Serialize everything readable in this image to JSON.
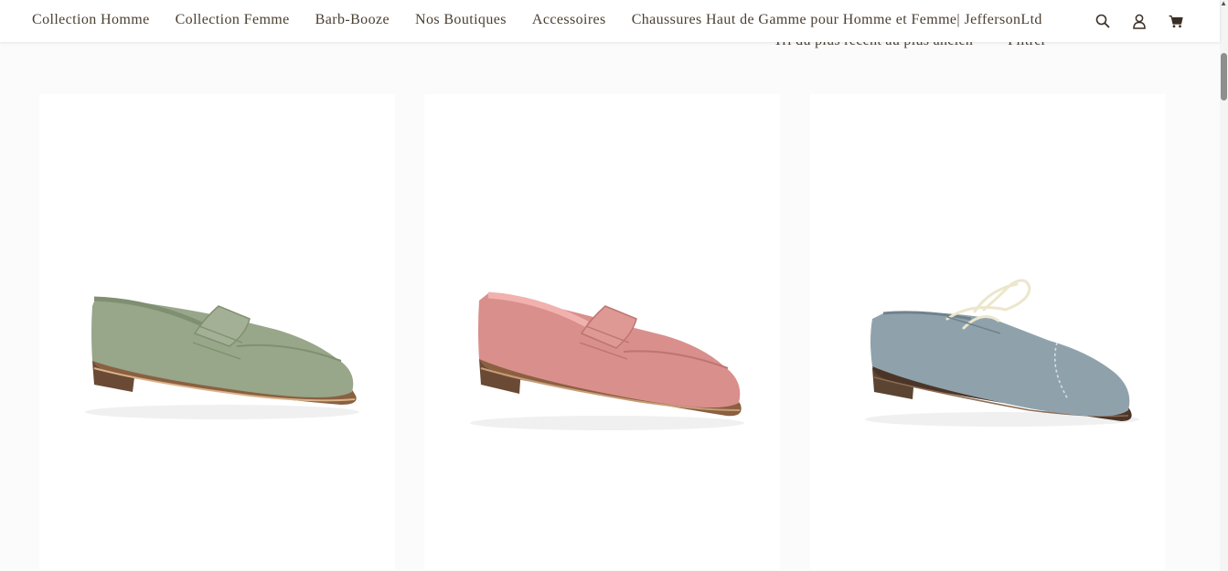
{
  "nav": {
    "links": [
      {
        "label": "Collection Homme"
      },
      {
        "label": "Collection Femme"
      },
      {
        "label": "Barb-Booze"
      },
      {
        "label": "Nos Boutiques"
      },
      {
        "label": "Accessoires"
      },
      {
        "label": "Chaussures Haut de Gamme pour Homme et Femme| JeffersonLtd"
      }
    ],
    "icons": [
      "search-icon",
      "account-icon",
      "cart-icon"
    ]
  },
  "toolbar": {
    "sort_label": "Tri du plus récent au plus ancien",
    "filter_label": "Filtrer"
  },
  "products": [
    {
      "image": "green-suede-penny-loafer",
      "color": "#98a68a"
    },
    {
      "image": "pink-suede-penny-loafer",
      "color": "#d98f8c"
    },
    {
      "image": "blue-grey-suede-oxford",
      "color": "#8fa2ac"
    }
  ],
  "theme": {
    "text": "#4b3e30",
    "background": "#fbfbfb"
  }
}
